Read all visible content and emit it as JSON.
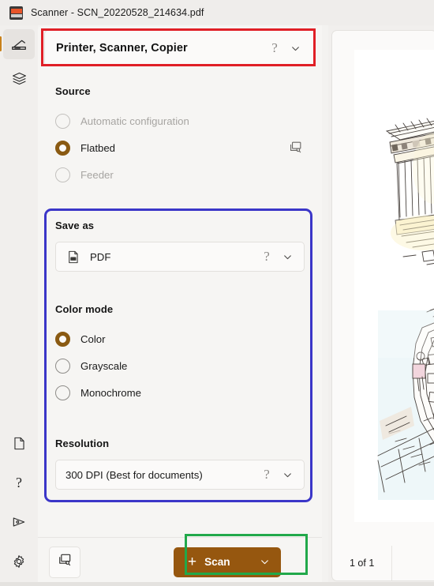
{
  "window": {
    "app_icon": "scanner-app-icon",
    "title": "Scanner  -   SCN_20220528_214634.pdf",
    "app_name": "Scanner",
    "document_name": "SCN_20220528_214634.pdf"
  },
  "rail": {
    "top_items": [
      {
        "id": "scan",
        "icon": "scanner-icon",
        "selected": true
      },
      {
        "id": "library",
        "icon": "stack-layers-icon",
        "selected": false
      }
    ],
    "bottom_items": [
      {
        "id": "pages",
        "icon": "page-document-icon"
      },
      {
        "id": "help",
        "icon": "question-mark-icon"
      },
      {
        "id": "feedback",
        "icon": "send-feedback-icon"
      },
      {
        "id": "settings",
        "icon": "gear-icon"
      }
    ]
  },
  "device": {
    "name": "Printer, Scanner, Copier",
    "help_glyph": "?",
    "chevron": "chevron-down-icon"
  },
  "source": {
    "label": "Source",
    "options": [
      {
        "label": "Automatic configuration",
        "selected": false,
        "enabled": false
      },
      {
        "label": "Flatbed",
        "selected": true,
        "enabled": true
      },
      {
        "label": "Feeder",
        "selected": false,
        "enabled": false
      }
    ],
    "preview_action_icon": "scan-preview-icon"
  },
  "save_as": {
    "label": "Save as",
    "value": "PDF",
    "value_icon": "pdf-file-icon",
    "help_glyph": "?",
    "chevron": "chevron-down-icon"
  },
  "color_mode": {
    "label": "Color mode",
    "options": [
      {
        "label": "Color",
        "selected": true
      },
      {
        "label": "Grayscale",
        "selected": false
      },
      {
        "label": "Monochrome",
        "selected": false
      }
    ]
  },
  "resolution": {
    "label": "Resolution",
    "value": "300 DPI (Best for documents)",
    "help_glyph": "?",
    "chevron": "chevron-down-icon"
  },
  "action_bar": {
    "preview_button_icon": "scan-preview-icon",
    "scan_label": "Scan",
    "scan_plus": "+",
    "scan_chevron": "chevron-down-icon"
  },
  "preview_pane": {
    "pager_text": "1 of 1",
    "page_alt": "scanned-sketch-of-greek-column-and-architectural-drawing"
  },
  "annotations": [
    {
      "id": "device-header-highlight",
      "color": "#e01f26"
    },
    {
      "id": "settings-group-highlight",
      "color": "#3b36c8"
    },
    {
      "id": "scan-button-highlight",
      "color": "#21a84a"
    }
  ],
  "colors": {
    "accent_orange": "#8a5a12",
    "scan_button": "#96570f",
    "rail_selected_pill": "#c8811a",
    "annotation_red": "#e01f26",
    "annotation_blue": "#3b36c8",
    "annotation_green": "#21a84a"
  }
}
